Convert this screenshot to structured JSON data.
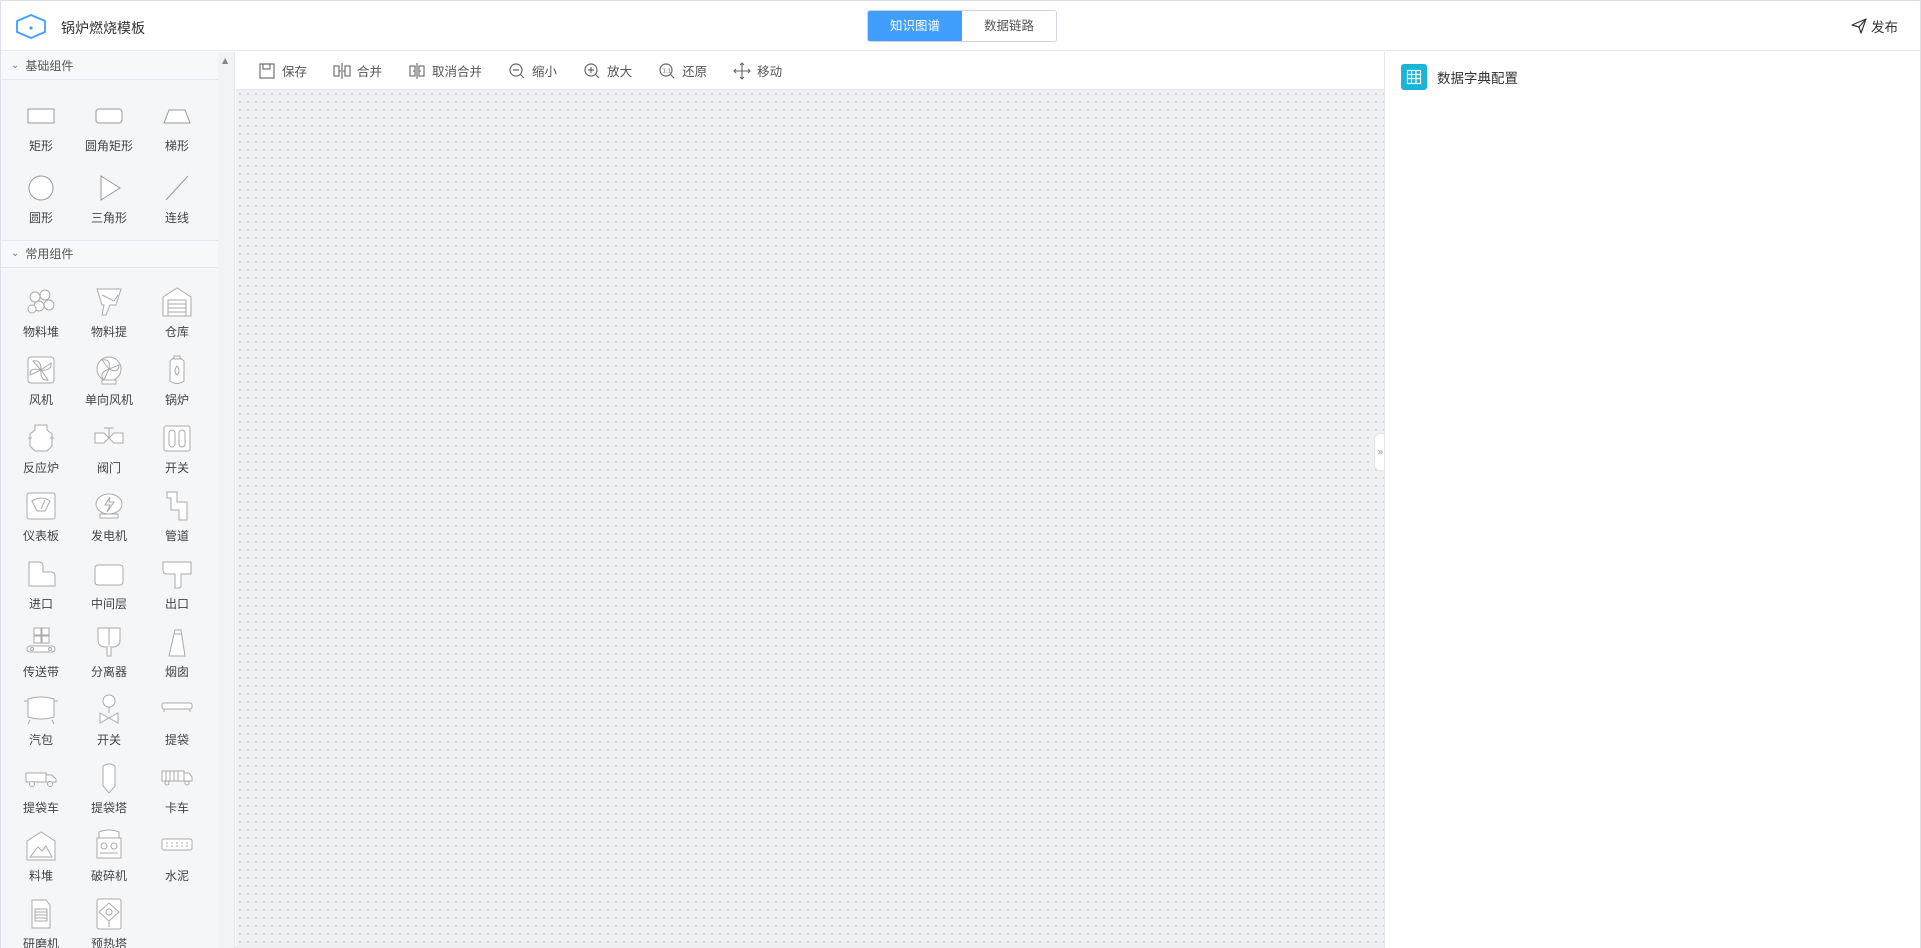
{
  "header": {
    "title": "锅炉燃烧模板",
    "tabs": [
      {
        "label": "知识图谱",
        "active": true
      },
      {
        "label": "数据链路",
        "active": false
      }
    ],
    "publish_label": "发布"
  },
  "sidebar": {
    "groups": [
      {
        "title": "基础组件",
        "items": [
          {
            "label": "矩形",
            "icon": "rectangle-icon"
          },
          {
            "label": "圆角矩形",
            "icon": "rounded-rectangle-icon"
          },
          {
            "label": "梯形",
            "icon": "trapezoid-icon"
          },
          {
            "label": "圆形",
            "icon": "circle-icon"
          },
          {
            "label": "三角形",
            "icon": "triangle-icon"
          },
          {
            "label": "连线",
            "icon": "line-icon"
          }
        ]
      },
      {
        "title": "常用组件",
        "items": [
          {
            "label": "物料堆",
            "icon": "material-pile-icon"
          },
          {
            "label": "物料提",
            "icon": "material-lift-icon"
          },
          {
            "label": "仓库",
            "icon": "warehouse-icon"
          },
          {
            "label": "风机",
            "icon": "fan-icon"
          },
          {
            "label": "单向风机",
            "icon": "oneway-fan-icon"
          },
          {
            "label": "锅炉",
            "icon": "boiler-icon"
          },
          {
            "label": "反应炉",
            "icon": "reactor-icon"
          },
          {
            "label": "阀门",
            "icon": "valve-icon"
          },
          {
            "label": "开关",
            "icon": "switch-icon"
          },
          {
            "label": "仪表板",
            "icon": "dashboard-icon"
          },
          {
            "label": "发电机",
            "icon": "generator-icon"
          },
          {
            "label": "管道",
            "icon": "pipe-icon"
          },
          {
            "label": "进口",
            "icon": "inlet-icon"
          },
          {
            "label": "中间层",
            "icon": "middle-layer-icon"
          },
          {
            "label": "出口",
            "icon": "outlet-icon"
          },
          {
            "label": "传送带",
            "icon": "conveyor-icon"
          },
          {
            "label": "分离器",
            "icon": "separator-icon"
          },
          {
            "label": "烟囱",
            "icon": "chimney-icon"
          },
          {
            "label": "汽包",
            "icon": "steam-drum-icon"
          },
          {
            "label": "开关",
            "icon": "switch-valve-icon"
          },
          {
            "label": "提袋",
            "icon": "bag-lift-icon"
          },
          {
            "label": "提袋车",
            "icon": "bag-truck-icon"
          },
          {
            "label": "提袋塔",
            "icon": "bag-tower-icon"
          },
          {
            "label": "卡车",
            "icon": "truck-icon"
          },
          {
            "label": "料堆",
            "icon": "stockpile-icon"
          },
          {
            "label": "破碎机",
            "icon": "crusher-icon"
          },
          {
            "label": "水泥",
            "icon": "cement-icon"
          },
          {
            "label": "研磨机",
            "icon": "grinder-icon"
          },
          {
            "label": "预热塔",
            "icon": "preheater-icon"
          }
        ]
      }
    ]
  },
  "toolbar": {
    "items": [
      {
        "label": "保存",
        "icon": "save-icon"
      },
      {
        "label": "合并",
        "icon": "merge-icon"
      },
      {
        "label": "取消合并",
        "icon": "unmerge-icon"
      },
      {
        "label": "缩小",
        "icon": "zoom-out-icon"
      },
      {
        "label": "放大",
        "icon": "zoom-in-icon"
      },
      {
        "label": "还原",
        "icon": "zoom-reset-icon"
      },
      {
        "label": "移动",
        "icon": "move-icon"
      }
    ]
  },
  "right_panel": {
    "title": "数据字典配置",
    "icon": "table-icon"
  },
  "colors": {
    "accent": "#409eff",
    "panel_icon": "#18b5d8",
    "canvas_bg": "#eef0f4"
  }
}
